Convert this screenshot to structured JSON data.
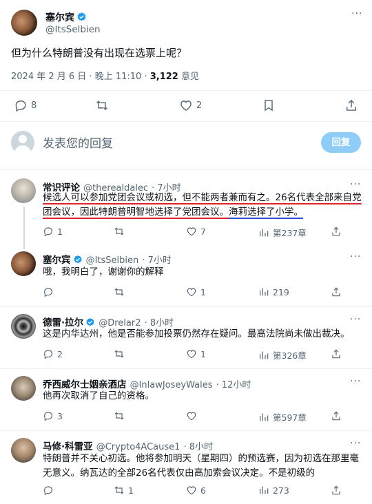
{
  "main_tweet": {
    "author_name": "塞尔宾",
    "author_handle": "@ItsSelbien",
    "text": "但为什么特朗普没有出现在选票上呢？",
    "date": "2024 年 2 月 6 日",
    "time": "晚上 11:10",
    "dot": " · ",
    "views_count": "3,122",
    "views_label": " 意见",
    "replies": "8",
    "likes": "2"
  },
  "composer": {
    "placeholder": "发表您的回复",
    "reply_button": "回复"
  },
  "replies": [
    {
      "name": "常识评论",
      "handle": "@therealdalec",
      "time": "· 7小时",
      "text_parts": [
        "候选人可以参加党团会议或初选，但不能两者兼而有之。26名代表全部来自党团会议，因此特朗普明智地选择了党团会议。",
        "海莉选择了小学。"
      ],
      "replies": "1",
      "likes": "7",
      "views": "第237章"
    },
    {
      "name": "塞尔宾",
      "handle": "@ItsSelbien",
      "time": "· 7小时",
      "text": "哦，我明白了，谢谢你的解释",
      "replies": "",
      "likes": "1",
      "views": "219"
    },
    {
      "name": "德雷·拉尔",
      "handle": "@Drelar2",
      "time": "· 8小时",
      "text": "这是内华达州，他是否能参加投票仍然存在疑问。最高法院尚未做出裁决。",
      "replies": "2",
      "likes": "1",
      "views": "第326章"
    },
    {
      "name": "乔西威尔士姻亲酒店",
      "handle": "@InlawJoseyWales",
      "time": "· 12小时",
      "text": "他再次取消了自己的资格。",
      "replies": "3",
      "likes": "",
      "views": "第597章"
    },
    {
      "name": "马修·科雷亚",
      "handle": "@Crypto4ACause1",
      "time": "· 8小时",
      "text_lines": [
        "特朗普并不关心初选。他将参加明天（星期四）的预选赛，因为初选在那里毫",
        "无意义。纳瓦达的全部26名代表仅由高加索会议决定。不是初级的"
      ],
      "replies": "",
      "retweets": "1",
      "likes": "6",
      "views": "273"
    }
  ],
  "colors": {
    "accent": "#1d9bf0",
    "reply_button_disabled": "#8ecdf8",
    "muted": "#536471",
    "annotation_red": "#d9232d",
    "annotation_blue": "#3249d6"
  }
}
